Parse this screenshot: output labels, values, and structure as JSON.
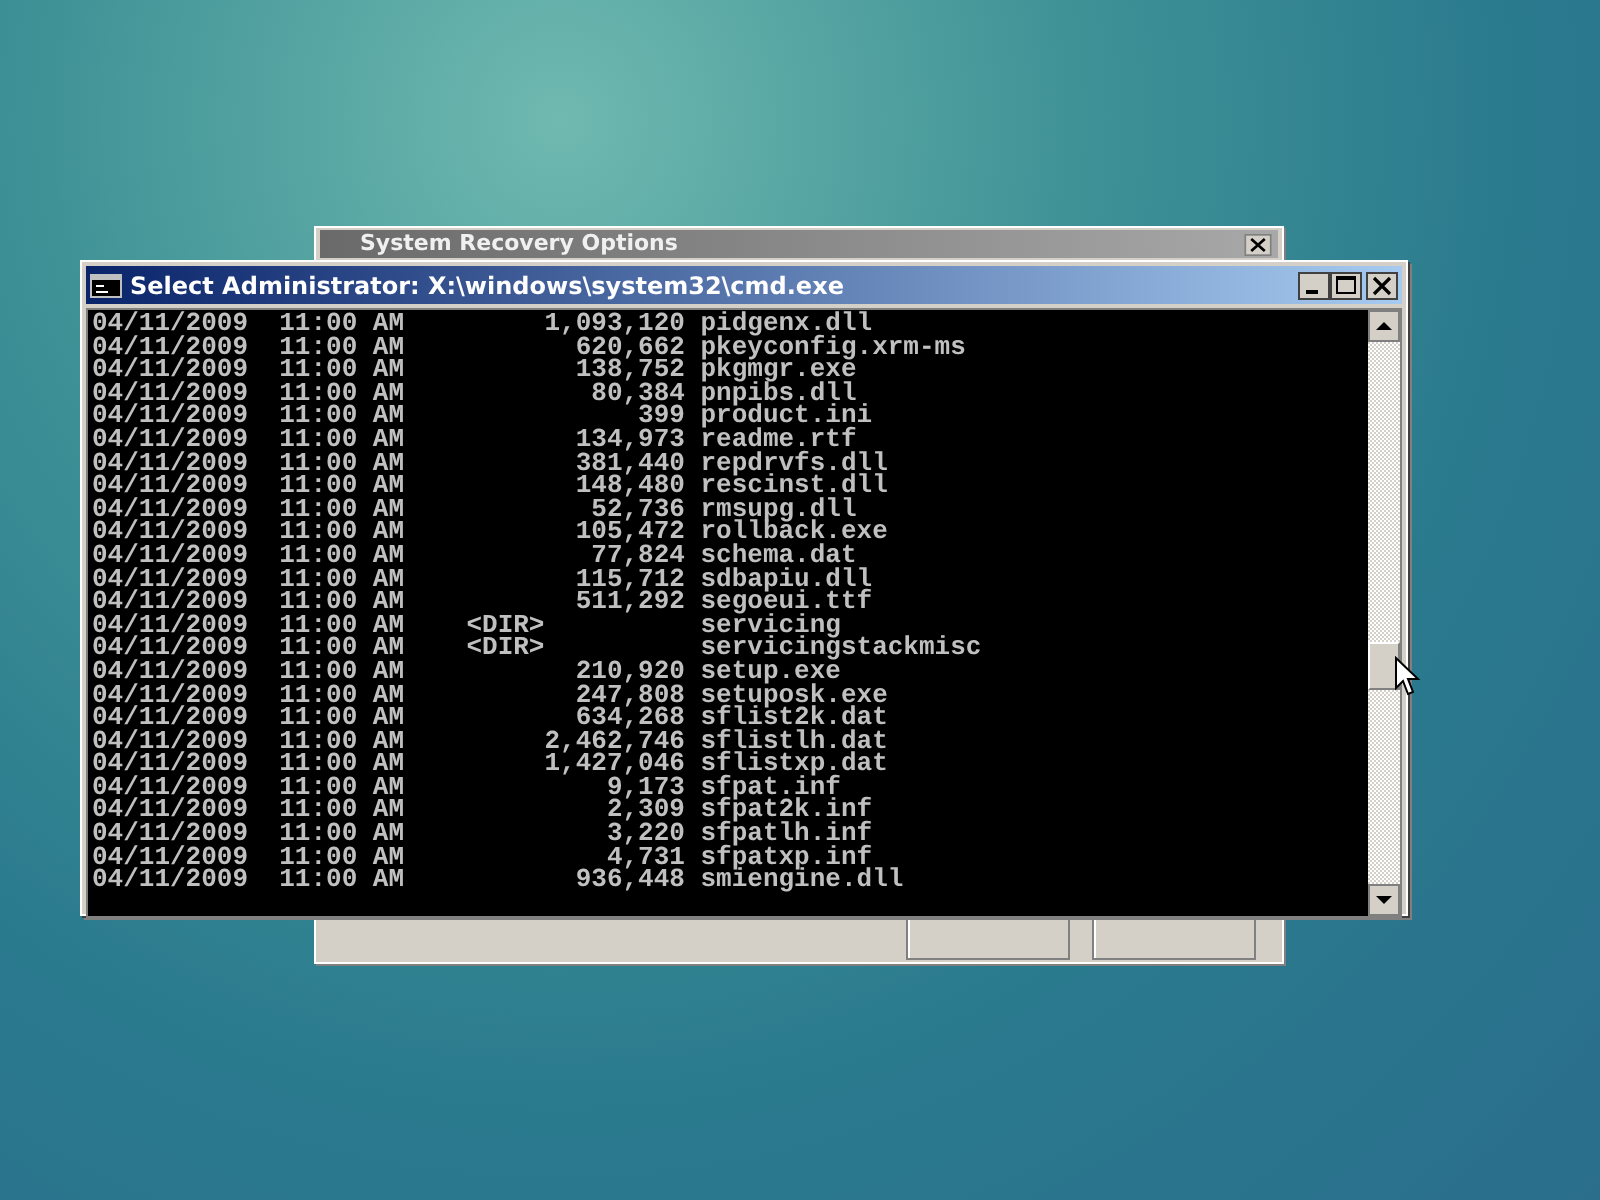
{
  "background_window": {
    "title": "System Recovery Options"
  },
  "window": {
    "title": "Select Administrator: X:\\windows\\system32\\cmd.exe",
    "lines": [
      {
        "kind": "file",
        "date": "04/11/2009",
        "time": "11:00 AM",
        "size": "1,093,120",
        "name": "pidgenx.dll"
      },
      {
        "kind": "file",
        "date": "04/11/2009",
        "time": "11:00 AM",
        "size": "620,662",
        "name": "pkeyconfig.xrm-ms"
      },
      {
        "kind": "file",
        "date": "04/11/2009",
        "time": "11:00 AM",
        "size": "138,752",
        "name": "pkgmgr.exe"
      },
      {
        "kind": "file",
        "date": "04/11/2009",
        "time": "11:00 AM",
        "size": "80,384",
        "name": "pnpibs.dll"
      },
      {
        "kind": "file",
        "date": "04/11/2009",
        "time": "11:00 AM",
        "size": "399",
        "name": "product.ini"
      },
      {
        "kind": "file",
        "date": "04/11/2009",
        "time": "11:00 AM",
        "size": "134,973",
        "name": "readme.rtf"
      },
      {
        "kind": "file",
        "date": "04/11/2009",
        "time": "11:00 AM",
        "size": "381,440",
        "name": "repdrvfs.dll"
      },
      {
        "kind": "file",
        "date": "04/11/2009",
        "time": "11:00 AM",
        "size": "148,480",
        "name": "rescinst.dll"
      },
      {
        "kind": "file",
        "date": "04/11/2009",
        "time": "11:00 AM",
        "size": "52,736",
        "name": "rmsupg.dll"
      },
      {
        "kind": "file",
        "date": "04/11/2009",
        "time": "11:00 AM",
        "size": "105,472",
        "name": "rollback.exe"
      },
      {
        "kind": "file",
        "date": "04/11/2009",
        "time": "11:00 AM",
        "size": "77,824",
        "name": "schema.dat"
      },
      {
        "kind": "file",
        "date": "04/11/2009",
        "time": "11:00 AM",
        "size": "115,712",
        "name": "sdbapiu.dll"
      },
      {
        "kind": "file",
        "date": "04/11/2009",
        "time": "11:00 AM",
        "size": "511,292",
        "name": "segoeui.ttf"
      },
      {
        "kind": "dir",
        "date": "04/11/2009",
        "time": "11:00 AM",
        "size": "<DIR>",
        "name": "servicing"
      },
      {
        "kind": "dir",
        "date": "04/11/2009",
        "time": "11:00 AM",
        "size": "<DIR>",
        "name": "servicingstackmisc"
      },
      {
        "kind": "file",
        "date": "04/11/2009",
        "time": "11:00 AM",
        "size": "210,920",
        "name": "setup.exe"
      },
      {
        "kind": "file",
        "date": "04/11/2009",
        "time": "11:00 AM",
        "size": "247,808",
        "name": "setuposk.exe"
      },
      {
        "kind": "file",
        "date": "04/11/2009",
        "time": "11:00 AM",
        "size": "634,268",
        "name": "sflist2k.dat"
      },
      {
        "kind": "file",
        "date": "04/11/2009",
        "time": "11:00 AM",
        "size": "2,462,746",
        "name": "sflistlh.dat"
      },
      {
        "kind": "file",
        "date": "04/11/2009",
        "time": "11:00 AM",
        "size": "1,427,046",
        "name": "sflistxp.dat"
      },
      {
        "kind": "file",
        "date": "04/11/2009",
        "time": "11:00 AM",
        "size": "9,173",
        "name": "sfpat.inf"
      },
      {
        "kind": "file",
        "date": "04/11/2009",
        "time": "11:00 AM",
        "size": "2,309",
        "name": "sfpat2k.inf"
      },
      {
        "kind": "file",
        "date": "04/11/2009",
        "time": "11:00 AM",
        "size": "3,220",
        "name": "sfpatlh.inf"
      },
      {
        "kind": "file",
        "date": "04/11/2009",
        "time": "11:00 AM",
        "size": "4,731",
        "name": "sfpatxp.inf"
      },
      {
        "kind": "file",
        "date": "04/11/2009",
        "time": "11:00 AM",
        "size": "936,448",
        "name": "smiengine.dll"
      }
    ]
  }
}
